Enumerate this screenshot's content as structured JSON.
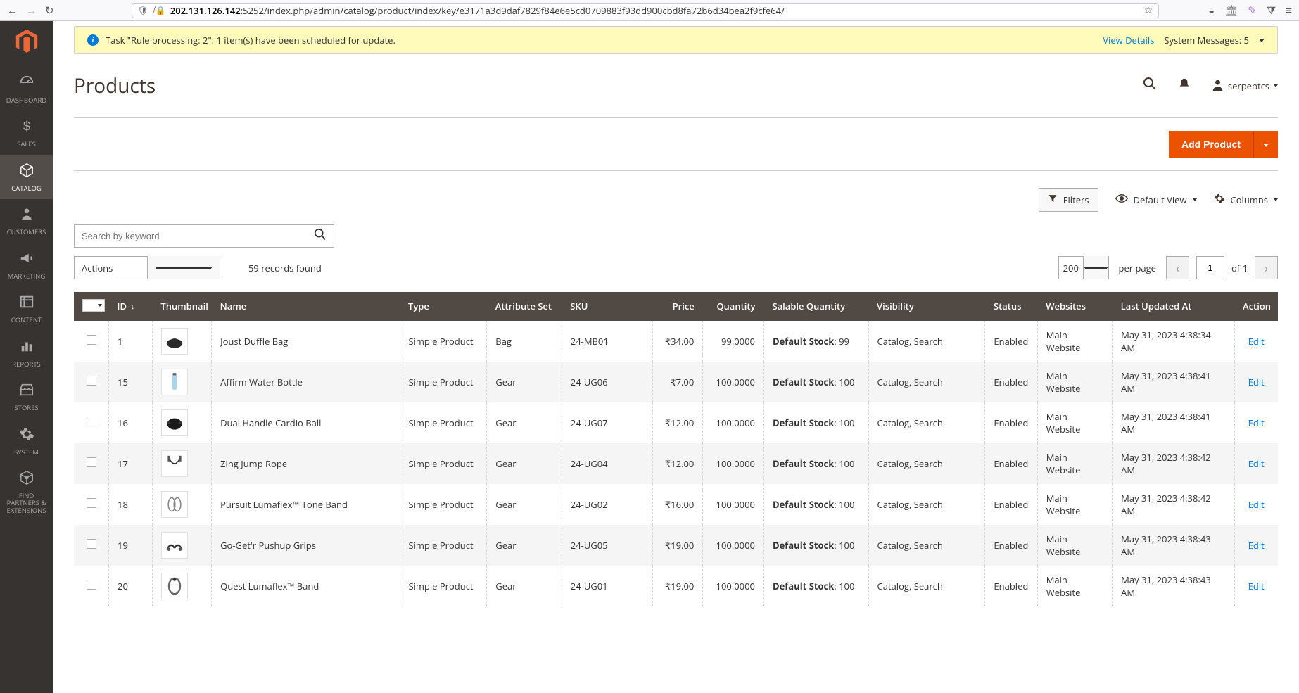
{
  "browser": {
    "url_host_prefix": "202.131.126.142",
    "url_rest": ":5252/index.php/admin/catalog/product/index/key/e3171a3d9daf7829f84e6e5cd0709883f93dd900cbd8fa72b6d34bea2f9cfe64/"
  },
  "sidebar": {
    "items": [
      {
        "icon": "gauge",
        "label": "DASHBOARD"
      },
      {
        "icon": "dollar",
        "label": "SALES"
      },
      {
        "icon": "cube",
        "label": "CATALOG"
      },
      {
        "icon": "person",
        "label": "CUSTOMERS"
      },
      {
        "icon": "megaphone",
        "label": "MARKETING"
      },
      {
        "icon": "news",
        "label": "CONTENT"
      },
      {
        "icon": "bars",
        "label": "REPORTS"
      },
      {
        "icon": "store",
        "label": "STORES"
      },
      {
        "icon": "gear",
        "label": "SYSTEM"
      },
      {
        "icon": "puzzle",
        "label": "FIND PARTNERS & EXTENSIONS"
      }
    ]
  },
  "notice": {
    "message": "Task \"Rule processing: 2\": 1 item(s) have been scheduled for update.",
    "view_details": "View Details",
    "system_messages": "System Messages: 5"
  },
  "page": {
    "title": "Products",
    "username": "serpentcs"
  },
  "actionbar": {
    "add_product": "Add Product"
  },
  "toolbar": {
    "filters": "Filters",
    "default_view": "Default View",
    "columns": "Columns",
    "search_placeholder": "Search by keyword",
    "actions": "Actions",
    "records_found": "59 records found",
    "per_page_value": "200",
    "per_page_label": "per page",
    "page_value": "1",
    "page_of": "of 1"
  },
  "table": {
    "headers": {
      "id": "ID",
      "thumbnail": "Thumbnail",
      "name": "Name",
      "type": "Type",
      "attribute_set": "Attribute Set",
      "sku": "SKU",
      "price": "Price",
      "quantity": "Quantity",
      "salable_quantity": "Salable Quantity",
      "visibility": "Visibility",
      "status": "Status",
      "websites": "Websites",
      "last_updated": "Last Updated At",
      "action": "Action"
    },
    "salable_prefix": "Default Stock",
    "edit_label": "Edit",
    "rows": [
      {
        "id": "1",
        "name": "Joust Duffle Bag",
        "type": "Simple Product",
        "attr": "Bag",
        "sku": "24-MB01",
        "price": "₹34.00",
        "qty": "99.0000",
        "salable": "99",
        "vis": "Catalog, Search",
        "status": "Enabled",
        "web": "Main Website",
        "upd": "May 31, 2023 4:38:34 AM",
        "thumb": "bag"
      },
      {
        "id": "15",
        "name": "Affirm Water Bottle",
        "type": "Simple Product",
        "attr": "Gear",
        "sku": "24-UG06",
        "price": "₹7.00",
        "qty": "100.0000",
        "salable": "100",
        "vis": "Catalog, Search",
        "status": "Enabled",
        "web": "Main Website",
        "upd": "May 31, 2023 4:38:41 AM",
        "thumb": "bottle"
      },
      {
        "id": "16",
        "name": "Dual Handle Cardio Ball",
        "type": "Simple Product",
        "attr": "Gear",
        "sku": "24-UG07",
        "price": "₹12.00",
        "qty": "100.0000",
        "salable": "100",
        "vis": "Catalog, Search",
        "status": "Enabled",
        "web": "Main Website",
        "upd": "May 31, 2023 4:38:41 AM",
        "thumb": "ball"
      },
      {
        "id": "17",
        "name": "Zing Jump Rope",
        "type": "Simple Product",
        "attr": "Gear",
        "sku": "24-UG04",
        "price": "₹12.00",
        "qty": "100.0000",
        "salable": "100",
        "vis": "Catalog, Search",
        "status": "Enabled",
        "web": "Main Website",
        "upd": "May 31, 2023 4:38:42 AM",
        "thumb": "rope"
      },
      {
        "id": "18",
        "name": "Pursuit Lumaflex™ Tone Band",
        "type": "Simple Product",
        "attr": "Gear",
        "sku": "24-UG02",
        "price": "₹16.00",
        "qty": "100.0000",
        "salable": "100",
        "vis": "Catalog, Search",
        "status": "Enabled",
        "web": "Main Website",
        "upd": "May 31, 2023 4:38:42 AM",
        "thumb": "band"
      },
      {
        "id": "19",
        "name": "Go-Get'r Pushup Grips",
        "type": "Simple Product",
        "attr": "Gear",
        "sku": "24-UG05",
        "price": "₹19.00",
        "qty": "100.0000",
        "salable": "100",
        "vis": "Catalog, Search",
        "status": "Enabled",
        "web": "Main Website",
        "upd": "May 31, 2023 4:38:43 AM",
        "thumb": "grips"
      },
      {
        "id": "20",
        "name": "Quest Lumaflex™ Band",
        "type": "Simple Product",
        "attr": "Gear",
        "sku": "24-UG01",
        "price": "₹19.00",
        "qty": "100.0000",
        "salable": "100",
        "vis": "Catalog, Search",
        "status": "Enabled",
        "web": "Main Website",
        "upd": "May 31, 2023 4:38:43 AM",
        "thumb": "band2"
      }
    ]
  }
}
